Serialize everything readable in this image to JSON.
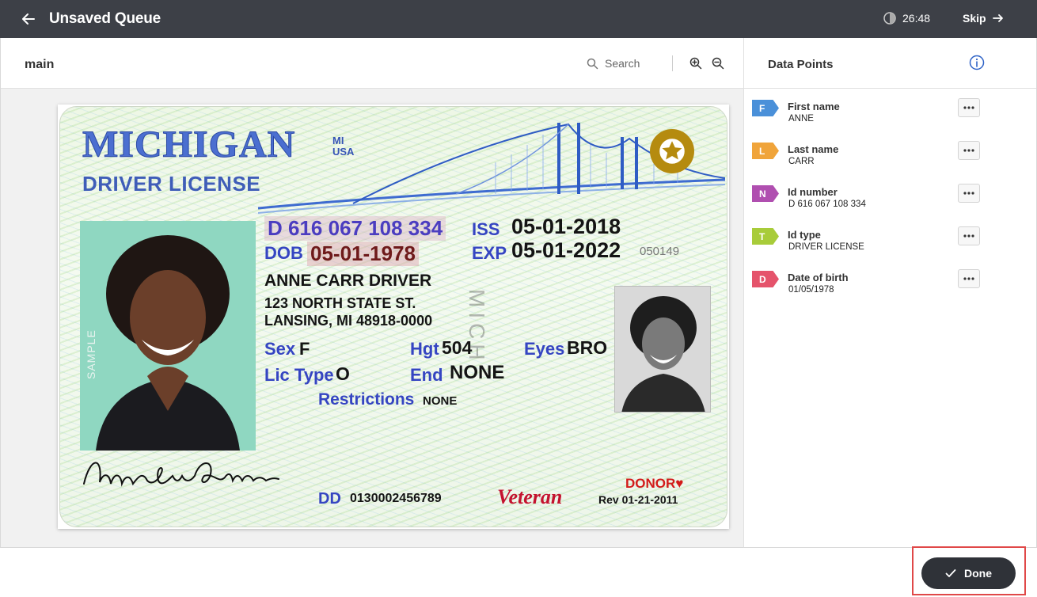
{
  "header": {
    "title": "Unsaved Queue",
    "timer": "26:48",
    "skip_label": "Skip"
  },
  "document": {
    "name": "main",
    "search_placeholder": "Search"
  },
  "license": {
    "state": "MICHIGAN",
    "state_abbr": "MI",
    "country": "USA",
    "type": "DRIVER LICENSE",
    "id_number": "D 616 067 108 334",
    "iss_label": "ISS",
    "iss_value": "05-01-2018",
    "dob_label": "DOB",
    "dob_value": "05-01-1978",
    "exp_label": "EXP",
    "exp_value": "05-01-2022",
    "small_number": "050149",
    "name_line": "ANNE CARR DRIVER",
    "address_1": "123 NORTH STATE ST.",
    "address_2": "LANSING, MI 48918-0000",
    "sex_label": "Sex",
    "sex_value": "F",
    "hgt_label": "Hgt",
    "hgt_value": "504",
    "eyes_label": "Eyes",
    "eyes_value": "BRO",
    "lic_type_label": "Lic Type",
    "lic_type_value": "O",
    "end_label": "End",
    "end_value": "NONE",
    "restrictions_label": "Restrictions",
    "restrictions_value": "NONE",
    "sample_text": "SAMPLE",
    "dd_label": "DD",
    "dd_value": "0130002456789",
    "veteran": "Veteran",
    "donor": "DONOR",
    "rev": "Rev 01-21-2011",
    "vertical_text": "MICH"
  },
  "data_points": {
    "title": "Data Points",
    "items": [
      {
        "tag": "F",
        "label": "First name",
        "value": "ANNE",
        "color": "#4a90d9"
      },
      {
        "tag": "L",
        "label": "Last name",
        "value": "CARR",
        "color": "#f0a43a"
      },
      {
        "tag": "N",
        "label": "Id number",
        "value": "D 616 067 108 334",
        "color": "#b04fb0"
      },
      {
        "tag": "T",
        "label": "Id type",
        "value": "DRIVER LICENSE",
        "color": "#a8cc3a"
      },
      {
        "tag": "D",
        "label": "Date of birth",
        "value": "01/05/1978",
        "color": "#e5536b"
      }
    ]
  },
  "footer": {
    "done_label": "Done"
  }
}
